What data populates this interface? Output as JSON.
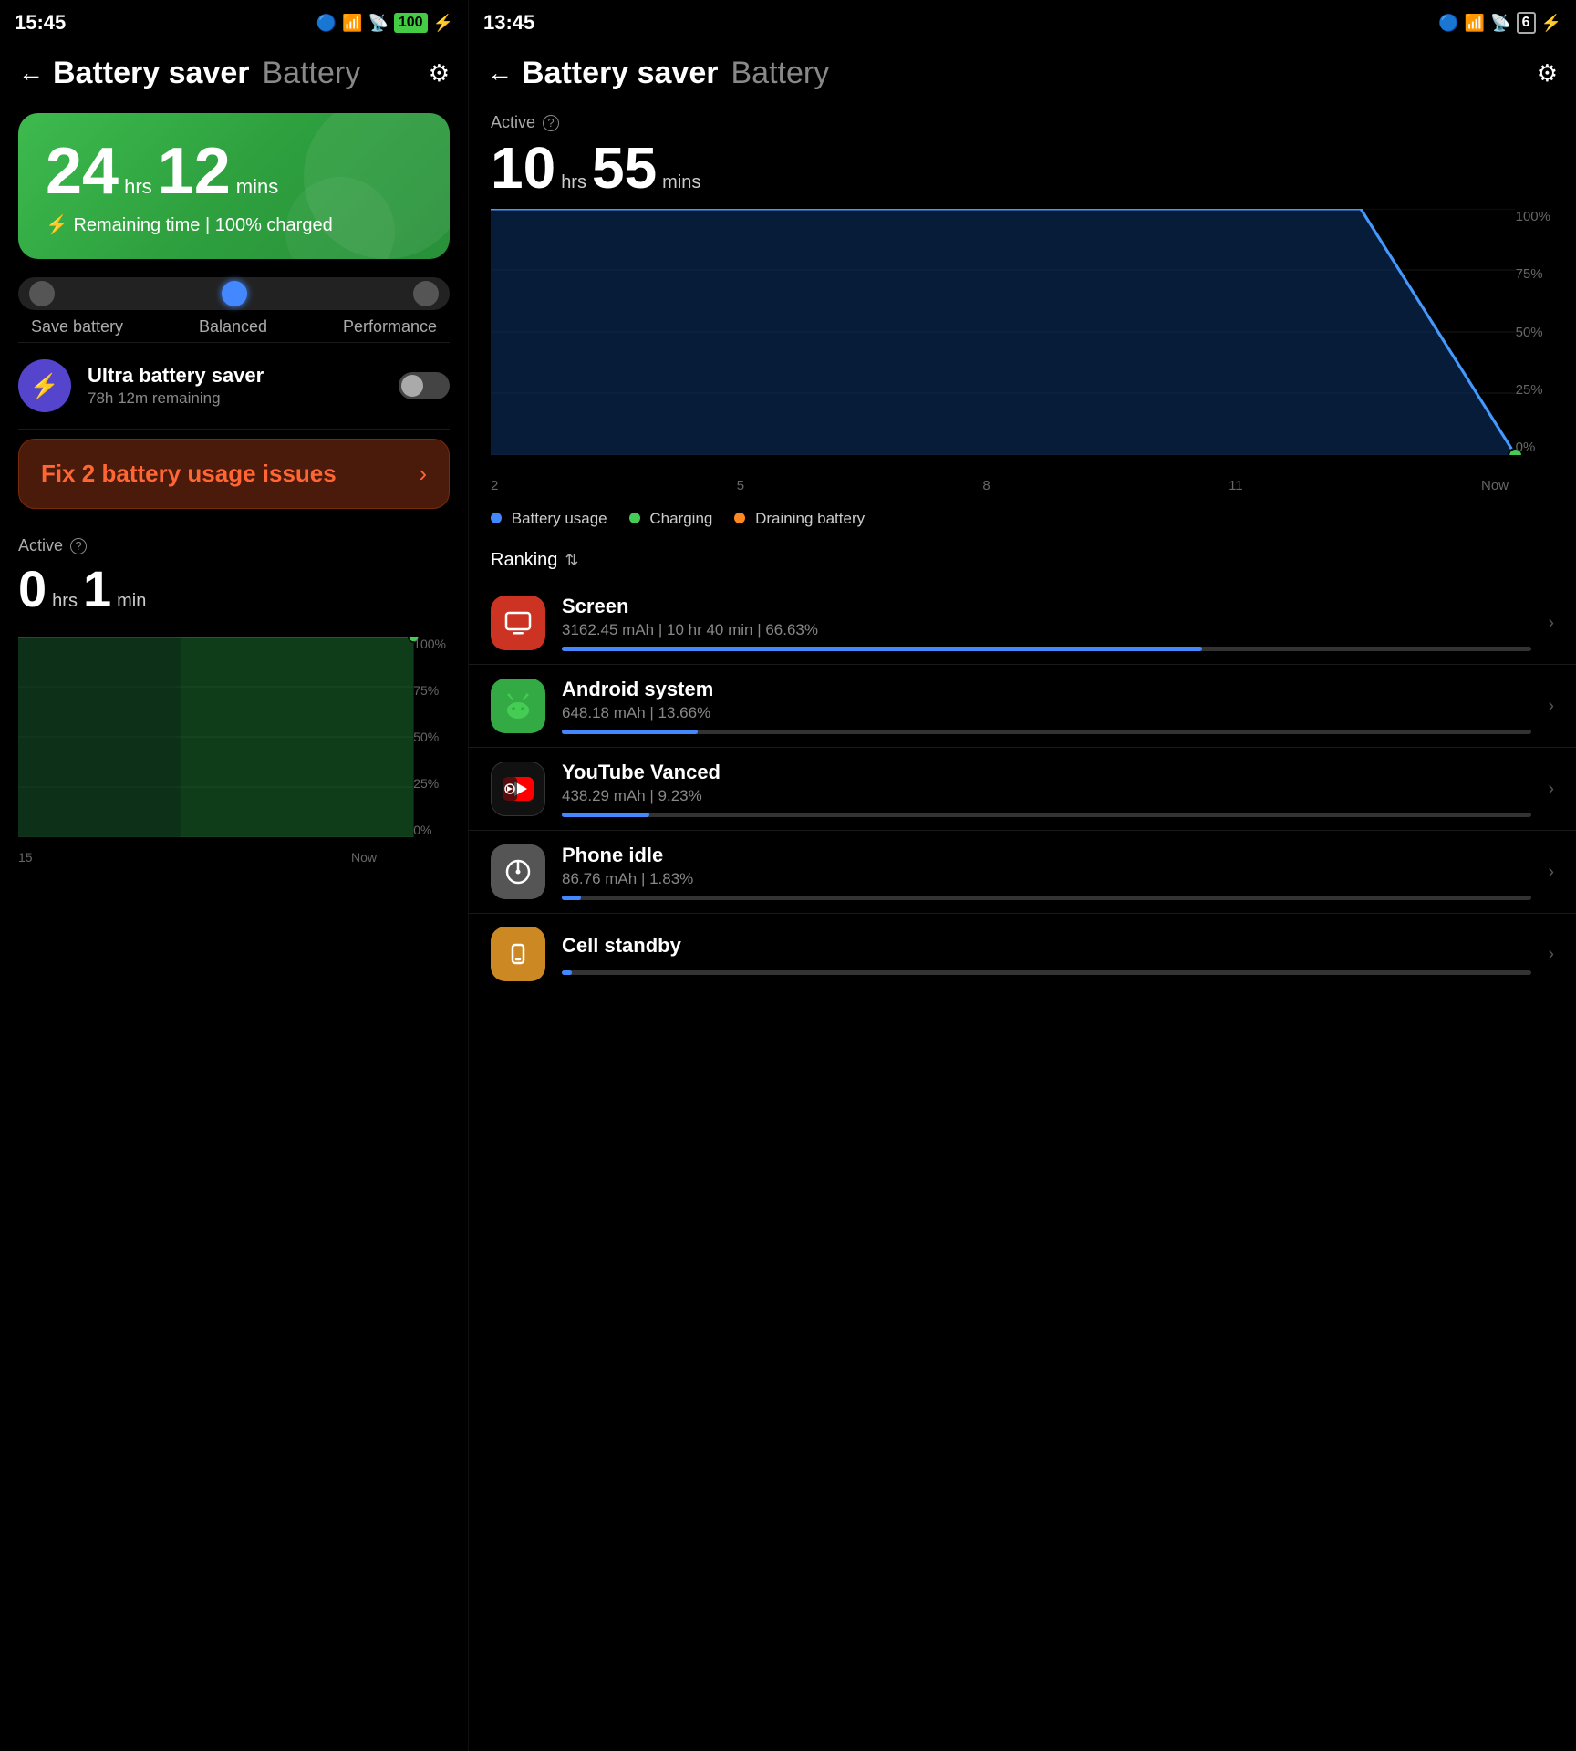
{
  "left": {
    "statusBar": {
      "time": "15:45",
      "icons": "📵 📶 🔋⚡"
    },
    "header": {
      "title": "Battery saver",
      "subtitle": "Battery",
      "back": "←",
      "settings": "⚙"
    },
    "batteryCard": {
      "hours": "24",
      "hrs_label": "hrs",
      "mins": "12",
      "mins_label": "mins",
      "remaining": "⚡ Remaining time | 100% charged"
    },
    "modes": {
      "left": "Save battery",
      "mid": "Balanced",
      "right": "Performance"
    },
    "ultraSaver": {
      "title": "Ultra battery saver",
      "subtitle": "78h 12m remaining"
    },
    "fixButton": {
      "text": "Fix 2 battery usage issues",
      "arrow": "›"
    },
    "active": {
      "label": "Active",
      "hours": "0",
      "hrs_label": "hrs",
      "mins": "1",
      "min_label": "min"
    },
    "chartXLabels": [
      "15",
      "Now"
    ],
    "chartYLabels": [
      "100%",
      "75%",
      "50%",
      "25%",
      "0%"
    ]
  },
  "right": {
    "statusBar": {
      "time": "13:45",
      "icons": "📵 🔋"
    },
    "header": {
      "title": "Battery saver",
      "subtitle": "Battery",
      "back": "←",
      "settings": "⚙"
    },
    "active": {
      "label": "Active",
      "hours": "10",
      "hrs_label": "hrs",
      "mins": "55",
      "mins_label": "mins"
    },
    "chartXLabels": [
      "2",
      "5",
      "8",
      "11",
      "Now"
    ],
    "chartYLabels": [
      "100%",
      "75%",
      "50%",
      "25%",
      "0%"
    ],
    "legend": [
      {
        "color": "#4488ff",
        "label": "Battery usage"
      },
      {
        "color": "#44cc55",
        "label": "Charging"
      },
      {
        "color": "#ff8822",
        "label": "Draining battery"
      }
    ],
    "ranking": {
      "label": "Ranking",
      "sort": "⇅"
    },
    "apps": [
      {
        "name": "Screen",
        "icon": "🟥",
        "iconBg": "#cc3322",
        "stats": "3162.45 mAh | 10 hr 40 min  | 66.63%",
        "barColor": "#4488ff",
        "barWidth": "66"
      },
      {
        "name": "Android system",
        "icon": "🤖",
        "iconBg": "#33aa44",
        "stats": "648.18 mAh | 13.66%",
        "barColor": "#4488ff",
        "barWidth": "14"
      },
      {
        "name": "YouTube Vanced",
        "icon": "▶",
        "iconBg": "#111",
        "stats": "438.29 mAh | 9.23%",
        "barColor": "#4488ff",
        "barWidth": "9"
      },
      {
        "name": "Phone idle",
        "icon": "⏻",
        "iconBg": "#444",
        "stats": "86.76 mAh | 1.83%",
        "barColor": "#4488ff",
        "barWidth": "2"
      },
      {
        "name": "Cell standby",
        "icon": "📶",
        "iconBg": "#cc8822",
        "stats": "",
        "barColor": "#4488ff",
        "barWidth": "1"
      }
    ]
  }
}
